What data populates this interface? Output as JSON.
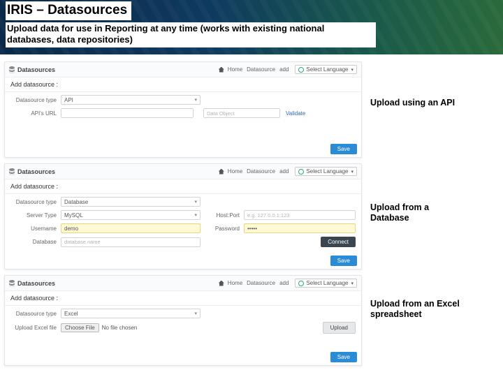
{
  "banner": {
    "title": "IRIS – Datasources",
    "subtitle": "Upload data for use in Reporting at any time (works with existing national databases, data repositories)"
  },
  "annotations": {
    "api": "Upload using an API",
    "db": "Upload from a Database",
    "excel": "Upload from an Excel spreadsheet"
  },
  "common": {
    "header_title": "Datasources",
    "home": "Home",
    "crumb_ds": "Datasource",
    "crumb_add": "add",
    "lang": "Select Language",
    "caret": "▾",
    "add_ds": "Add datasource :",
    "type_label": "Datasource type",
    "save": "Save"
  },
  "panel_api": {
    "type_value": "API",
    "url_label": "API's URL",
    "data_obj_label": "Data Object",
    "validate": "Validate"
  },
  "panel_db": {
    "type_value": "Database",
    "server_label": "Server Type",
    "server_value": "MySQL",
    "hostport_label": "Host:Port",
    "hostport_ph": "e.g. 127.0.0.1:123",
    "user_label": "Username",
    "user_value": "demo",
    "pass_label": "Password",
    "pass_value": "•••••",
    "db_label": "Database",
    "db_ph": "database name",
    "connect": "Connect"
  },
  "panel_excel": {
    "type_value": "Excel",
    "file_label": "Upload Excel file",
    "choose": "Choose File",
    "nofile": "No file chosen",
    "upload": "Upload"
  }
}
